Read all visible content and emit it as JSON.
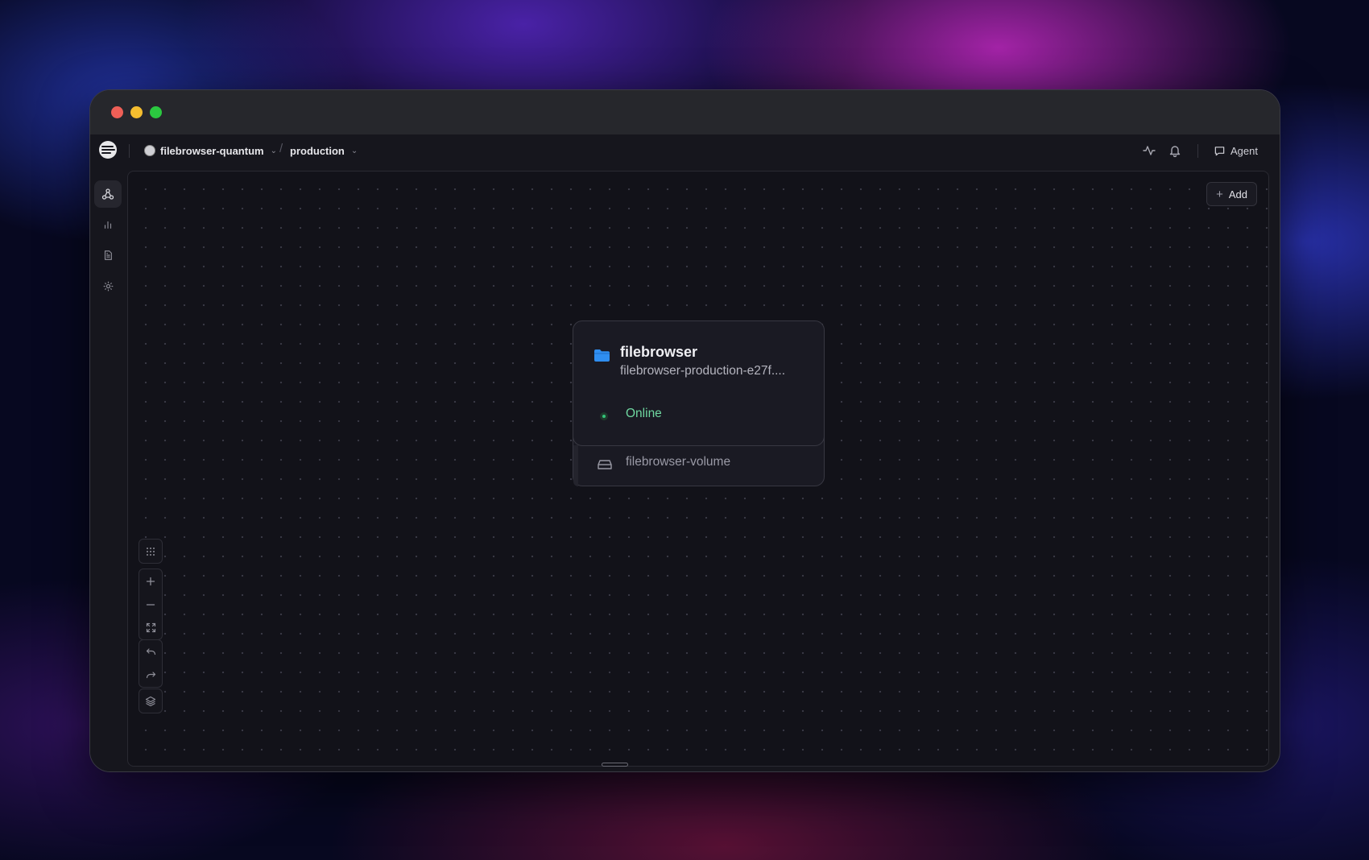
{
  "app": {
    "project": "filebrowser-quantum",
    "environment": "production"
  },
  "header": {
    "agent_label": "Agent",
    "icons": [
      "activity-icon",
      "bell-icon",
      "message-icon"
    ]
  },
  "sidebar": {
    "items": [
      {
        "name": "architecture",
        "icon": "nodes-icon",
        "active": true
      },
      {
        "name": "metrics",
        "icon": "bar-chart-icon",
        "active": false
      },
      {
        "name": "logs",
        "icon": "document-icon",
        "active": false
      },
      {
        "name": "settings",
        "icon": "gear-icon",
        "active": false
      }
    ]
  },
  "canvas": {
    "add_label": "Add",
    "service": {
      "name": "filebrowser",
      "domain": "filebrowser-production-e27f....",
      "status": "Online",
      "volume": "filebrowser-volume",
      "icon": "folder-icon"
    },
    "controls": [
      "grid-icon",
      "zoom-in-icon",
      "zoom-out-icon",
      "fit-view-icon",
      "undo-icon",
      "redo-icon",
      "layers-icon"
    ]
  },
  "colors": {
    "accent_folder": "#2f8ef0",
    "status_online": "#33c47a"
  }
}
